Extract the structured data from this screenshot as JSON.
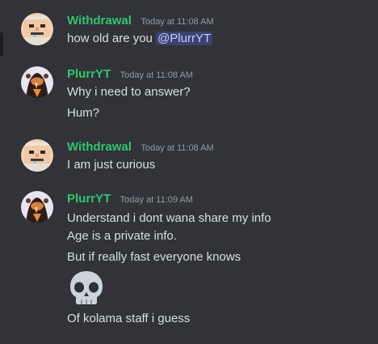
{
  "theme": {
    "background": "#313338",
    "author_color": "#2dc770",
    "text_color": "#dbdee1",
    "timestamp_color": "#949ba4",
    "mention_bg": "#41437a"
  },
  "messages": [
    {
      "author": "Withdrawal",
      "timestamp": "Today at 11:08 AM",
      "lines": [
        "how old are you"
      ],
      "mention": "@PlurrYT"
    },
    {
      "author": "PlurrYT",
      "timestamp": "Today at 11:08 AM",
      "lines": [
        "Why i need to answer?",
        "Hum?"
      ]
    },
    {
      "author": "Withdrawal",
      "timestamp": "Today at 11:08 AM",
      "lines": [
        "I am just curious"
      ]
    },
    {
      "author": "PlurrYT",
      "timestamp": "Today at 11:09 AM",
      "lines": [
        "Understand i dont wana share my info",
        "Age is a private info.",
        "But if really fast everyone knows",
        "Of kolama staff i guess"
      ],
      "emoji": "skull-emoji"
    }
  ]
}
